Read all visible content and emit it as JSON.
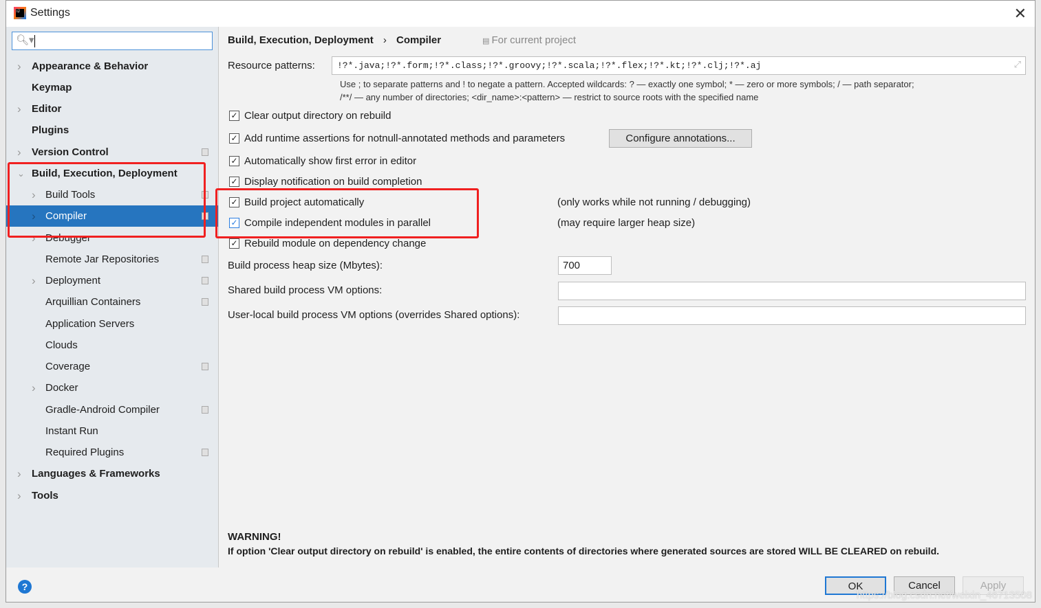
{
  "window": {
    "title": "Settings",
    "close_icon": "close-icon"
  },
  "sidebar": {
    "search_placeholder": "",
    "items": [
      {
        "label": "Appearance & Behavior",
        "bold": true,
        "level": 0,
        "chevron": "right"
      },
      {
        "label": "Keymap",
        "bold": true,
        "level": 0
      },
      {
        "label": "Editor",
        "bold": true,
        "level": 0,
        "chevron": "right"
      },
      {
        "label": "Plugins",
        "bold": true,
        "level": 0
      },
      {
        "label": "Version Control",
        "bold": true,
        "level": 0,
        "chevron": "right",
        "project_icon": true
      },
      {
        "label": "Build, Execution, Deployment",
        "bold": true,
        "level": 0,
        "chevron": "down"
      },
      {
        "label": "Build Tools",
        "level": 1,
        "chevron": "right",
        "project_icon": true
      },
      {
        "label": "Compiler",
        "level": 1,
        "chevron": "right",
        "project_icon": true,
        "selected": true
      },
      {
        "label": "Debugger",
        "level": 1,
        "chevron": "right"
      },
      {
        "label": "Remote Jar Repositories",
        "level": 1,
        "project_icon": true
      },
      {
        "label": "Deployment",
        "level": 1,
        "chevron": "right",
        "project_icon": true
      },
      {
        "label": "Arquillian Containers",
        "level": 1,
        "project_icon": true
      },
      {
        "label": "Application Servers",
        "level": 1
      },
      {
        "label": "Clouds",
        "level": 1
      },
      {
        "label": "Coverage",
        "level": 1,
        "project_icon": true
      },
      {
        "label": "Docker",
        "level": 1,
        "chevron": "right"
      },
      {
        "label": "Gradle-Android Compiler",
        "level": 1,
        "project_icon": true
      },
      {
        "label": "Instant Run",
        "level": 1
      },
      {
        "label": "Required Plugins",
        "level": 1,
        "project_icon": true
      },
      {
        "label": "Languages & Frameworks",
        "bold": true,
        "level": 0,
        "chevron": "right"
      },
      {
        "label": "Tools",
        "bold": true,
        "level": 0,
        "chevron": "right"
      }
    ]
  },
  "main": {
    "breadcrumb": [
      "Build, Execution, Deployment",
      "Compiler"
    ],
    "scope": "For current project",
    "resource_label": "Resource patterns:",
    "resource_value": "!?*.java;!?*.form;!?*.class;!?*.groovy;!?*.scala;!?*.flex;!?*.kt;!?*.clj;!?*.aj",
    "hint1": "Use ; to separate patterns and ! to negate a pattern. Accepted wildcards: ? — exactly one symbol; * — zero or more symbols; / — path separator;",
    "hint2": "/**/ — any number of directories; <dir_name>:<pattern> — restrict to source roots with the specified name",
    "options": [
      {
        "label": "Clear output directory on rebuild",
        "checked": true
      },
      {
        "label": "Add runtime assertions for notnull-annotated methods and parameters",
        "checked": true
      },
      {
        "label": "Automatically show first error in editor",
        "checked": true
      },
      {
        "label": "Display notification on build completion",
        "checked": true
      },
      {
        "label": "Build project automatically",
        "checked": true,
        "note": "(only works while not running / debugging)"
      },
      {
        "label": "Compile independent modules in parallel",
        "checked": true,
        "note": "(may require larger heap size)"
      },
      {
        "label": "Rebuild module on dependency change",
        "checked": true
      }
    ],
    "configure_button": "Configure annotations...",
    "heap_label": "Build process heap size (Mbytes):",
    "heap_value": "700",
    "shared_vm_label": "Shared build process VM options:",
    "shared_vm_value": "",
    "user_vm_label": "User-local build process VM options (overrides Shared options):",
    "user_vm_value": "",
    "warning_title": "WARNING!",
    "warning_text": "If option 'Clear output directory on rebuild' is enabled, the entire contents of directories where generated sources are stored WILL BE CLEARED on rebuild."
  },
  "footer": {
    "help_icon": "help-icon",
    "ok": "OK",
    "cancel": "Cancel",
    "apply": "Apply",
    "watermark": "https://blog.csdn.net/weixin_46713508"
  },
  "colors": {
    "selection": "#2675bf",
    "annotation": "#f02020",
    "sidebar_bg": "#e6eaee"
  }
}
